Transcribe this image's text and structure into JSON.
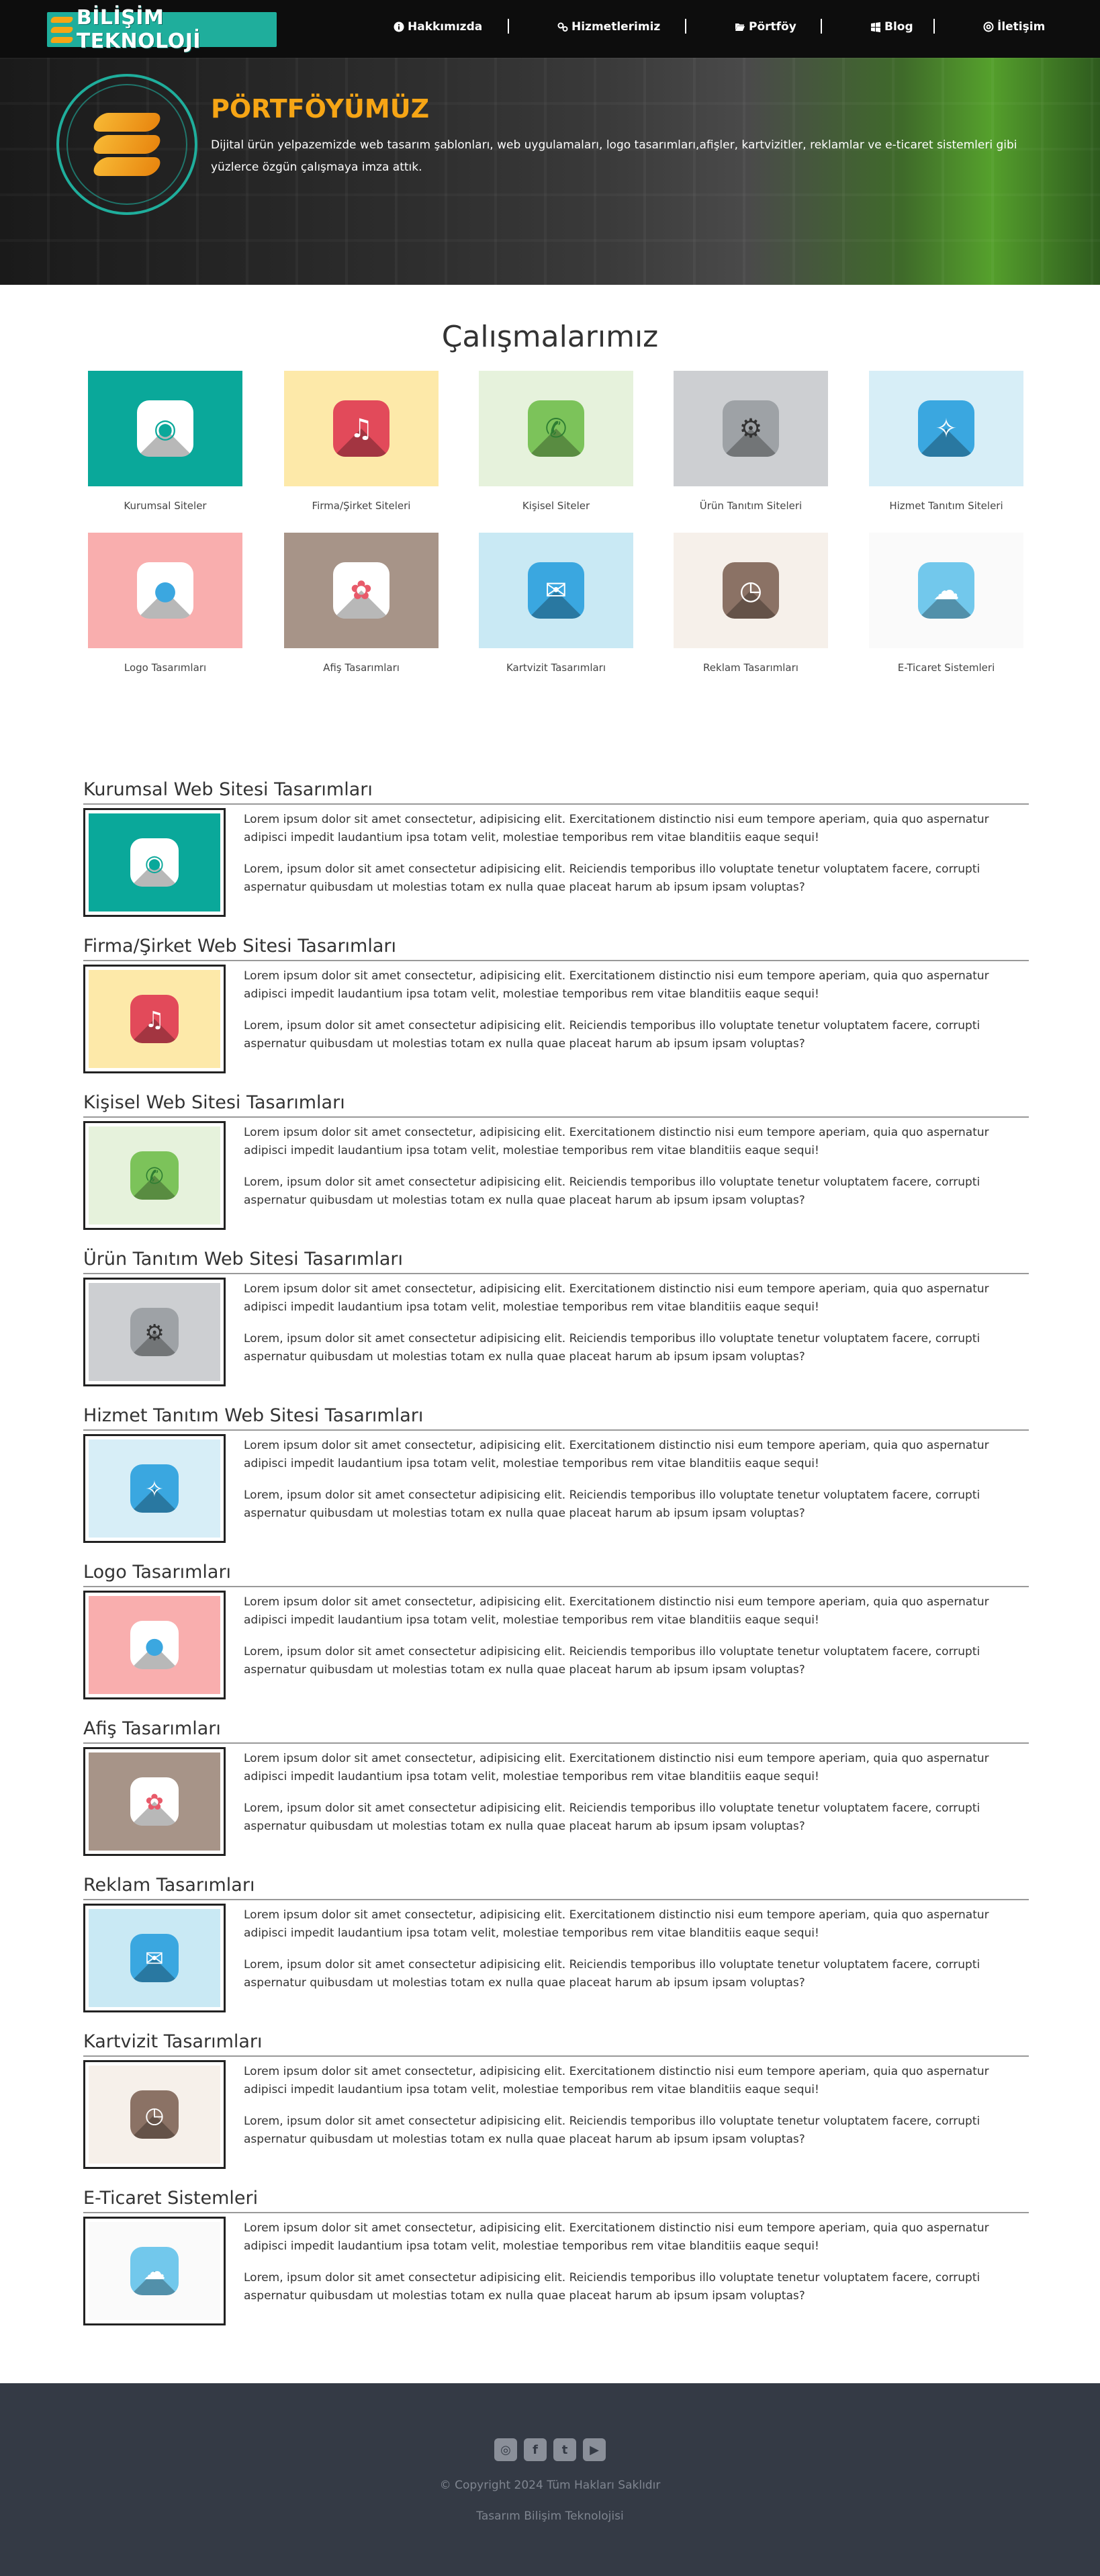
{
  "brand": {
    "logo_text": "BİLİŞİM TEKNOLOJİ"
  },
  "nav": {
    "items": [
      {
        "label": "Hakkımızda",
        "icon": "info-circle-icon"
      },
      {
        "label": "Hizmetlerimiz",
        "icon": "gears-icon"
      },
      {
        "label": "Pörtföy",
        "icon": "folder-open-icon"
      },
      {
        "label": "Blog",
        "icon": "windows-icon"
      },
      {
        "label": "İletişim",
        "icon": "at-icon"
      }
    ]
  },
  "hero": {
    "title": "PÖRTFÖYÜMÜZ",
    "description": "Dijital ürün yelpazemizde web tasarım şablonları, web uygulamaları, logo tasarımları,afişler, kartvizitler, reklamlar ve e-ticaret sistemleri gibi yüzlerce özgün çalışmaya imza attık."
  },
  "works": {
    "title": "Çalışmalarımız",
    "items": [
      {
        "label": "Kurumsal Siteler",
        "bg": "#0aa89a",
        "icon": "camera-icon"
      },
      {
        "label": "Firma/Şirket Siteleri",
        "bg": "#fde9a9",
        "icon": "music-note-icon"
      },
      {
        "label": "Kişisel Siteler",
        "bg": "#e6f2dc",
        "icon": "phone-icon"
      },
      {
        "label": "Ürün Tanıtım Siteleri",
        "bg": "#cdcfd2",
        "icon": "gear-icon"
      },
      {
        "label": "Hizmet Tanıtım Siteleri",
        "bg": "#d7eef7",
        "icon": "compass-icon"
      },
      {
        "label": "Logo Tasarımları",
        "bg": "#f9aeae",
        "icon": "color-circles-icon"
      },
      {
        "label": "Afiş Tasarımları",
        "bg": "#a79488",
        "icon": "flower-icon"
      },
      {
        "label": "Kartvizit Tasarımları",
        "bg": "#c9e9f4",
        "icon": "envelope-icon"
      },
      {
        "label": "Reklam Tasarımları",
        "bg": "#f6f0ea",
        "icon": "clock-icon"
      },
      {
        "label": "E-Ticaret Sistemleri",
        "bg": "#fafafa",
        "icon": "weather-icon"
      }
    ]
  },
  "sections": [
    {
      "title": "Kurumsal Web Sitesi Tasarımları",
      "bg": "#0aa89a",
      "icon": "camera-icon",
      "p1": "Lorem ipsum dolor sit amet consectetur, adipisicing elit. Exercitationem distinctio nisi eum tempore aperiam, quia quo aspernatur adipisci impedit laudantium ipsa totam velit, molestiae temporibus rem vitae blanditiis eaque sequi!",
      "p2": "Lorem, ipsum dolor sit amet consectetur adipisicing elit. Reiciendis temporibus illo voluptate tenetur voluptatem facere, corrupti aspernatur quibusdam ut molestias totam ex nulla quae placeat harum ab ipsum ipsam voluptas?"
    },
    {
      "title": "Firma/Şirket Web Sitesi Tasarımları",
      "bg": "#fde9a9",
      "icon": "music-note-icon",
      "p1": "Lorem ipsum dolor sit amet consectetur, adipisicing elit. Exercitationem distinctio nisi eum tempore aperiam, quia quo aspernatur adipisci impedit laudantium ipsa totam velit, molestiae temporibus rem vitae blanditiis eaque sequi!",
      "p2": "Lorem, ipsum dolor sit amet consectetur adipisicing elit. Reiciendis temporibus illo voluptate tenetur voluptatem facere, corrupti aspernatur quibusdam ut molestias totam ex nulla quae placeat harum ab ipsum ipsam voluptas?"
    },
    {
      "title": "Kişisel Web Sitesi Tasarımları",
      "bg": "#e6f2dc",
      "icon": "phone-icon",
      "p1": "Lorem ipsum dolor sit amet consectetur, adipisicing elit. Exercitationem distinctio nisi eum tempore aperiam, quia quo aspernatur adipisci impedit laudantium ipsa totam velit, molestiae temporibus rem vitae blanditiis eaque sequi!",
      "p2": "Lorem, ipsum dolor sit amet consectetur adipisicing elit. Reiciendis temporibus illo voluptate tenetur voluptatem facere, corrupti aspernatur quibusdam ut molestias totam ex nulla quae placeat harum ab ipsum ipsam voluptas?"
    },
    {
      "title": "Ürün Tanıtım Web Sitesi Tasarımları",
      "bg": "#cdcfd2",
      "icon": "gear-icon",
      "p1": "Lorem ipsum dolor sit amet consectetur, adipisicing elit. Exercitationem distinctio nisi eum tempore aperiam, quia quo aspernatur adipisci impedit laudantium ipsa totam velit, molestiae temporibus rem vitae blanditiis eaque sequi!",
      "p2": "Lorem, ipsum dolor sit amet consectetur adipisicing elit. Reiciendis temporibus illo voluptate tenetur voluptatem facere, corrupti aspernatur quibusdam ut molestias totam ex nulla quae placeat harum ab ipsum ipsam voluptas?"
    },
    {
      "title": "Hizmet Tanıtım Web Sitesi Tasarımları",
      "bg": "#d7eef7",
      "icon": "compass-icon",
      "p1": "Lorem ipsum dolor sit amet consectetur, adipisicing elit. Exercitationem distinctio nisi eum tempore aperiam, quia quo aspernatur adipisci impedit laudantium ipsa totam velit, molestiae temporibus rem vitae blanditiis eaque sequi!",
      "p2": "Lorem, ipsum dolor sit amet consectetur adipisicing elit. Reiciendis temporibus illo voluptate tenetur voluptatem facere, corrupti aspernatur quibusdam ut molestias totam ex nulla quae placeat harum ab ipsum ipsam voluptas?"
    },
    {
      "title": "Logo Tasarımları",
      "bg": "#f9aeae",
      "icon": "color-circles-icon",
      "p1": "Lorem ipsum dolor sit amet consectetur, adipisicing elit. Exercitationem distinctio nisi eum tempore aperiam, quia quo aspernatur adipisci impedit laudantium ipsa totam velit, molestiae temporibus rem vitae blanditiis eaque sequi!",
      "p2": "Lorem, ipsum dolor sit amet consectetur adipisicing elit. Reiciendis temporibus illo voluptate tenetur voluptatem facere, corrupti aspernatur quibusdam ut molestias totam ex nulla quae placeat harum ab ipsum ipsam voluptas?"
    },
    {
      "title": "Afiş Tasarımları",
      "bg": "#a79488",
      "icon": "flower-icon",
      "p1": "Lorem ipsum dolor sit amet consectetur, adipisicing elit. Exercitationem distinctio nisi eum tempore aperiam, quia quo aspernatur adipisci impedit laudantium ipsa totam velit, molestiae temporibus rem vitae blanditiis eaque sequi!",
      "p2": "Lorem, ipsum dolor sit amet consectetur adipisicing elit. Reiciendis temporibus illo voluptate tenetur voluptatem facere, corrupti aspernatur quibusdam ut molestias totam ex nulla quae placeat harum ab ipsum ipsam voluptas?"
    },
    {
      "title": "Reklam Tasarımları",
      "bg": "#c9e9f4",
      "icon": "envelope-icon",
      "p1": "Lorem ipsum dolor sit amet consectetur, adipisicing elit. Exercitationem distinctio nisi eum tempore aperiam, quia quo aspernatur adipisci impedit laudantium ipsa totam velit, molestiae temporibus rem vitae blanditiis eaque sequi!",
      "p2": "Lorem, ipsum dolor sit amet consectetur adipisicing elit. Reiciendis temporibus illo voluptate tenetur voluptatem facere, corrupti aspernatur quibusdam ut molestias totam ex nulla quae placeat harum ab ipsum ipsam voluptas?"
    },
    {
      "title": "Kartvizit Tasarımları",
      "bg": "#f6f0ea",
      "icon": "clock-icon",
      "p1": "Lorem ipsum dolor sit amet consectetur, adipisicing elit. Exercitationem distinctio nisi eum tempore aperiam, quia quo aspernatur adipisci impedit laudantium ipsa totam velit, molestiae temporibus rem vitae blanditiis eaque sequi!",
      "p2": "Lorem, ipsum dolor sit amet consectetur adipisicing elit. Reiciendis temporibus illo voluptate tenetur voluptatem facere, corrupti aspernatur quibusdam ut molestias totam ex nulla quae placeat harum ab ipsum ipsam voluptas?"
    },
    {
      "title": "E-Ticaret Sistemleri",
      "bg": "#fafafa",
      "icon": "weather-icon",
      "p1": "Lorem ipsum dolor sit amet consectetur, adipisicing elit. Exercitationem distinctio nisi eum tempore aperiam, quia quo aspernatur adipisci impedit laudantium ipsa totam velit, molestiae temporibus rem vitae blanditiis eaque sequi!",
      "p2": "Lorem, ipsum dolor sit amet consectetur adipisicing elit. Reiciendis temporibus illo voluptate tenetur voluptatem facere, corrupti aspernatur quibusdam ut molestias totam ex nulla quae placeat harum ab ipsum ipsam voluptas?"
    }
  ],
  "footer": {
    "social": [
      "instagram-icon",
      "facebook-icon",
      "twitter-icon",
      "youtube-icon"
    ],
    "copyright": "© Copyright 2024 Tüm Hakları Saklıdır",
    "design": "Tasarım Bilişim Teknolojisi"
  },
  "colors": {
    "accent": "#f6a515",
    "teal": "#1fae9c",
    "footer_bg": "#343a45"
  }
}
